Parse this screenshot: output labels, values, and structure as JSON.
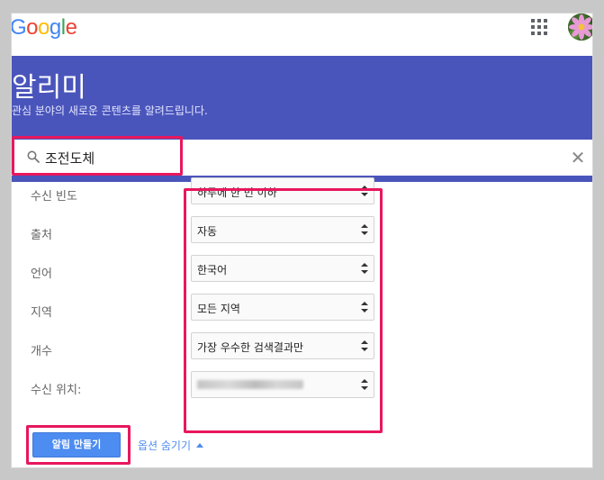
{
  "header": {
    "logo_letters": [
      "G",
      "o",
      "o",
      "g",
      "l",
      "e"
    ],
    "logo_colors": [
      "#4285f4",
      "#ea4335",
      "#fbbc05",
      "#4285f4",
      "#34a853",
      "#ea4335"
    ],
    "apps_icon": "apps-grid-icon",
    "avatar_icon": "user-avatar-flower"
  },
  "banner": {
    "title": "알리미",
    "subtitle": "관심 분야의 새로운 콘텐츠를 알려드립니다.",
    "color": "#4a55bb"
  },
  "search": {
    "value": "조전도체",
    "placeholder": "",
    "icon": "search-icon",
    "clear_icon": "close-icon",
    "clear_glyph": "✕"
  },
  "options": [
    {
      "label": "수신 빈도",
      "value": "하루에 한 번 이하"
    },
    {
      "label": "출처",
      "value": "자동"
    },
    {
      "label": "언어",
      "value": "한국어"
    },
    {
      "label": "지역",
      "value": "모든 지역"
    },
    {
      "label": "개수",
      "value": "가장 우수한 검색결과만"
    },
    {
      "label": "수신 위치:",
      "value": ""
    }
  ],
  "footer": {
    "create_label": "알림 만들기",
    "hide_options_label": "옵션 숨기기",
    "button_color": "#4d8cf0"
  },
  "highlight_color": "#e8175d"
}
